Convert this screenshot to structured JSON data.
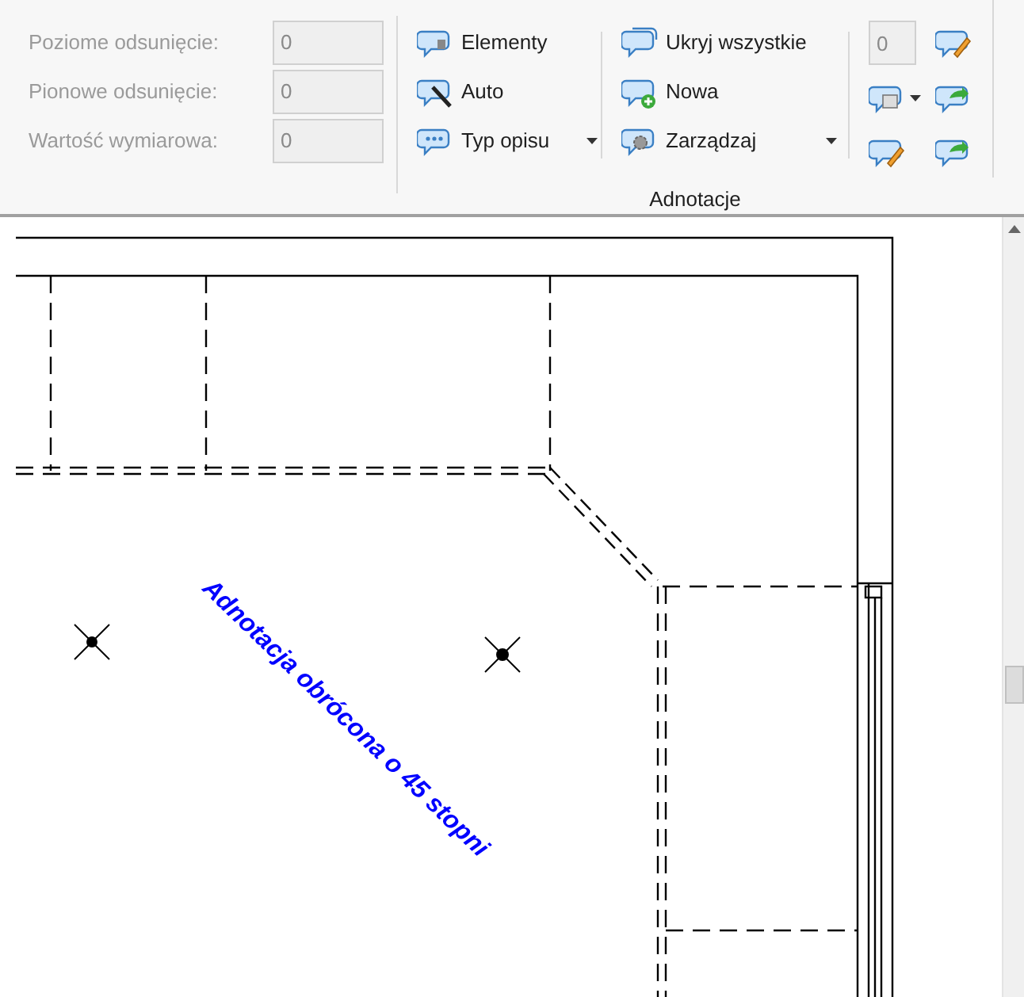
{
  "ribbon": {
    "fields": [
      {
        "label": "Poziome odsunięcie:",
        "value": "0",
        "disabled": true
      },
      {
        "label": "Pionowe odsunięcie:",
        "value": "0",
        "disabled": true
      },
      {
        "label": "Wartość wymiarowa:",
        "value": "0",
        "disabled": true
      }
    ],
    "column_1": [
      {
        "kind": "elements",
        "label": "Elementy",
        "dropdown": false
      },
      {
        "kind": "auto",
        "label": "Auto",
        "dropdown": false
      },
      {
        "kind": "numbers",
        "label": "Typ opisu",
        "dropdown": true
      }
    ],
    "column_2": [
      {
        "kind": "hide",
        "label": "Ukryj wszystkie",
        "dropdown": false
      },
      {
        "kind": "new",
        "label": "Nowa",
        "dropdown": false
      },
      {
        "kind": "manage",
        "label": "Zarządzaj",
        "dropdown": true
      }
    ],
    "small_field": {
      "value": "0",
      "disabled": true
    },
    "group_label": "Adnotacje"
  },
  "canvas": {
    "annotation": {
      "text": "Adnotacja obrócona o 45 stopni",
      "color": "#0000ff"
    }
  }
}
